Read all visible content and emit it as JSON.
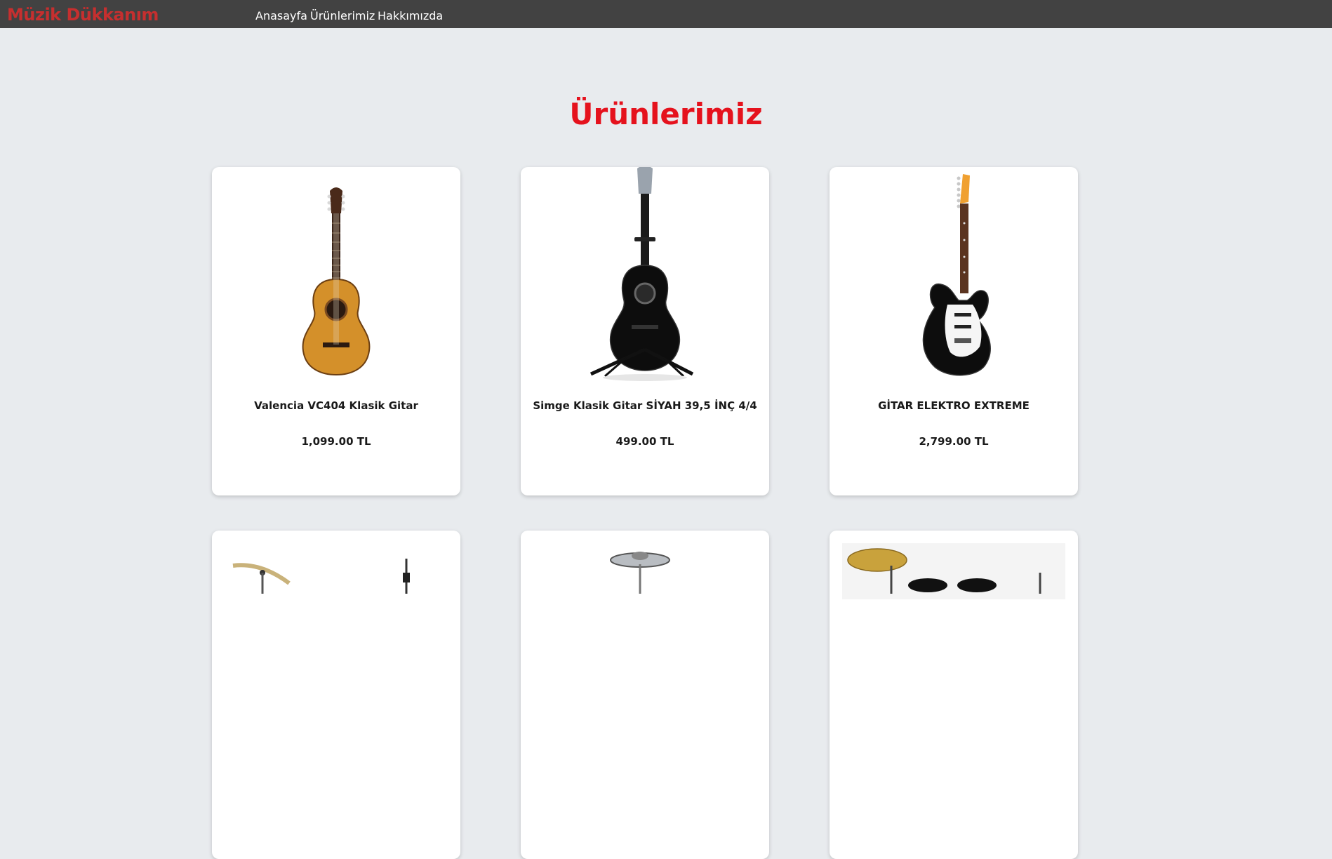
{
  "nav": {
    "brand": "Müzik Dükkanım",
    "links": [
      "Anasayfa",
      "Ürünlerimiz",
      "Hakkımızda"
    ]
  },
  "page": {
    "title": "Ürünlerimiz"
  },
  "products": [
    {
      "name": "Valencia VC404 Klasik Gitar",
      "price": "1,099.00 TL"
    },
    {
      "name": "Simge Klasik Gitar SİYAH 39,5 İNÇ 4/4",
      "price": "499.00 TL"
    },
    {
      "name": "GİTAR ELEKTRO EXTREME",
      "price": "2,799.00 TL"
    }
  ],
  "colors": {
    "navbar": "#424242",
    "brand": "#c62f2f",
    "title": "#e5121d",
    "background": "#e8ebee",
    "card": "#ffffff"
  },
  "icons": [
    "classical-guitar-image",
    "black-classical-guitar-image",
    "electric-guitar-image",
    "cymbal-stand-image",
    "cymbal-image",
    "drum-kit-image"
  ]
}
